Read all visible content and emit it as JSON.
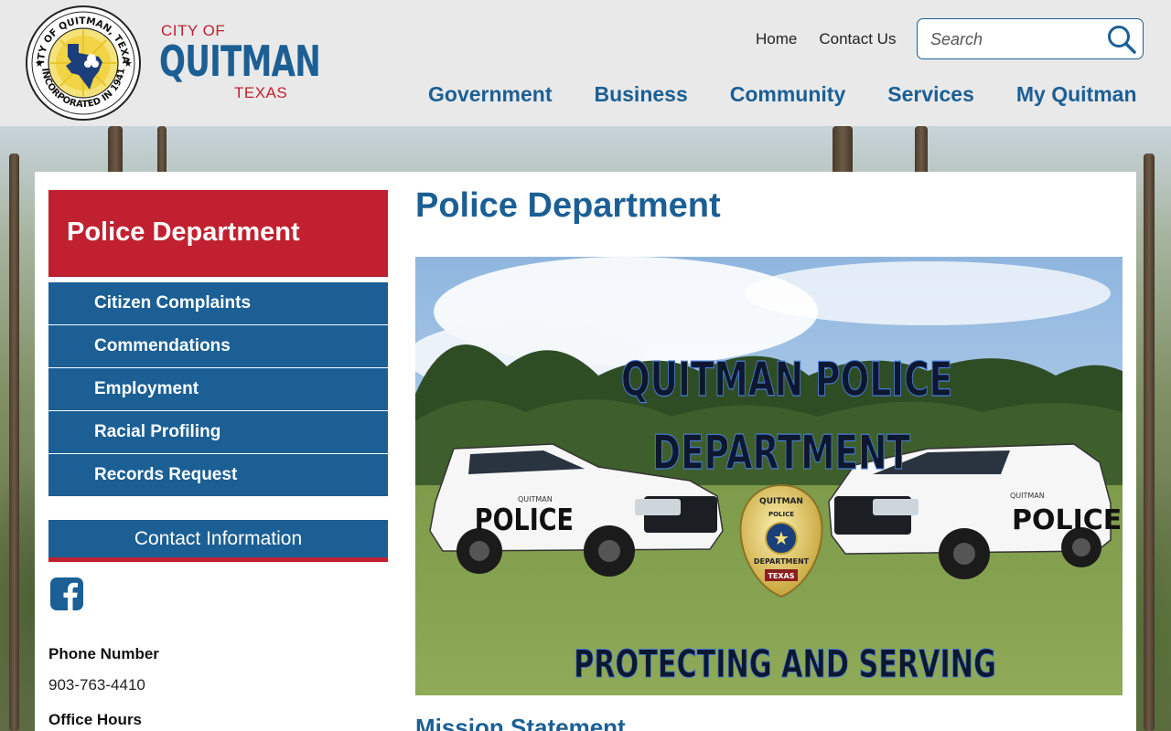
{
  "header": {
    "seal": {
      "top_text": "CITY OF QUITMAN, TEXAS",
      "bottom_text": "INCORPORATED IN 1941"
    },
    "logo": {
      "line1": "CITY OF",
      "line2": "QUITMAN",
      "line3": "TEXAS"
    },
    "top_links": [
      "Home",
      "Contact Us"
    ],
    "search": {
      "placeholder": "Search",
      "value": "",
      "icon": "search-icon"
    },
    "main_nav": [
      "Government",
      "Business",
      "Community",
      "Services",
      "My Quitman"
    ]
  },
  "sidebar": {
    "title": "Police Department",
    "items": [
      "Citizen Complaints",
      "Commendations",
      "Employment",
      "Racial Profiling",
      "Records Request"
    ],
    "contact": {
      "heading": "Contact Information",
      "social_icon": "facebook-icon",
      "phone_label": "Phone Number",
      "phone_value": "903-763-4410",
      "hours_label": "Office Hours"
    }
  },
  "main": {
    "title": "Police Department",
    "hero": {
      "line1": "QUITMAN  POLICE",
      "line2": "DEPARTMENT",
      "line3": "PROTECTING AND SERVING",
      "vehicle_text": "POLICE",
      "vehicle_small_text": "QUITMAN",
      "badge_top": "QUITMAN",
      "badge_mid": "POLICE",
      "badge_dept": "DEPARTMENT",
      "badge_state": "TEXAS"
    },
    "section_heading": "Mission Statement"
  },
  "colors": {
    "brand_blue": "#1b5f95",
    "brand_red": "#c0202f",
    "header_bg": "#e9e9e9"
  }
}
